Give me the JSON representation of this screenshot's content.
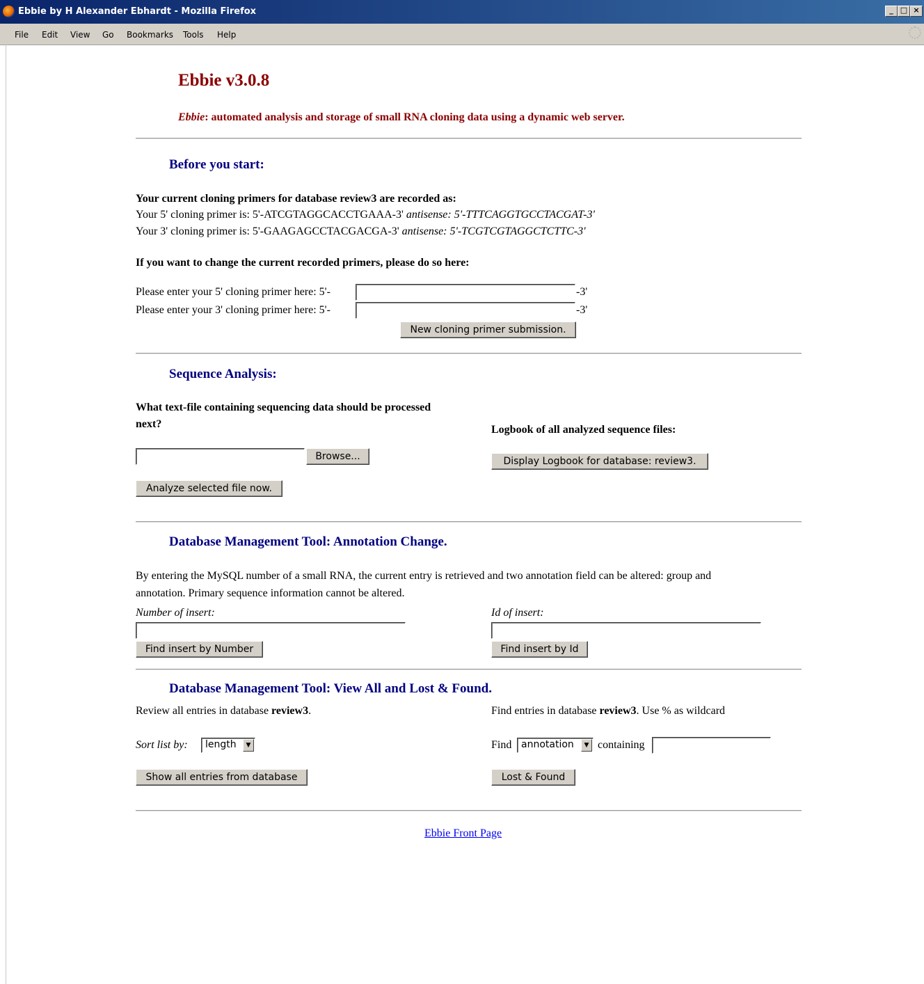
{
  "window": {
    "title": "Ebbie by H Alexander Ebhardt - Mozilla Firefox",
    "controls": [
      "_",
      "□",
      "×"
    ]
  },
  "menu": [
    "File",
    "Edit",
    "View",
    "Go",
    "Bookmarks",
    "Tools",
    "Help"
  ],
  "header": {
    "title": "Ebbie v3.0.8",
    "subtitle_italic": "Ebbie",
    "subtitle_rest": ": automated analysis and storage of small RNA cloning data using a dynamic web server."
  },
  "before": {
    "heading": "Before you start:",
    "recorded_label": "Your current cloning primers for database review3 are recorded as:",
    "primer5_text": "Your 5' cloning primer is: 5'-ATCGTAGGCACCTGAAA-3'",
    "primer5_antisense_label": "antisense:",
    "primer5_antisense": "5'-TTTCAGGTGCCTACGAT-3'",
    "primer3_text": "Your 3' cloning primer is: 5'-GAAGAGCCTACGACGA-3'",
    "primer3_antisense_label": "antisense:",
    "primer3_antisense": "5'-TCGTCGTAGGCTCTTC-3'",
    "change_label": "If you want to change the current recorded primers, please do so here:",
    "enter5_label": "Please enter your 5' cloning primer here: 5'-",
    "enter3_label": "Please enter your 3' cloning primer here: 5'-",
    "suffix": "-3'",
    "enter5_value": "",
    "enter3_value": "",
    "submit_label": "New cloning primer submission."
  },
  "analysis": {
    "heading": "Sequence Analysis:",
    "question_line1": "What text-file containing sequencing data should be processed",
    "question_line2": "next?",
    "file_value": "",
    "browse_label": "Browse...",
    "analyze_label": "Analyze selected file now.",
    "logbook_label": "Logbook of all analyzed sequence files:",
    "logbook_button": "Display Logbook for database: review3."
  },
  "annotation": {
    "heading": "Database Management Tool: Annotation Change.",
    "desc_line1": "By entering the MySQL number of a small RNA, the current entry is retrieved and two annotation field can be altered: group and",
    "desc_line2": "annotation. Primary sequence information cannot be altered.",
    "number_label": "Number of insert:",
    "number_value": "",
    "find_number_button": "Find insert by Number",
    "id_label": "Id of insert:",
    "id_value": "",
    "find_id_button": "Find insert by Id"
  },
  "viewall": {
    "heading": "Database Management Tool: View All and Lost & Found.",
    "review_prefix": "Review all entries in database ",
    "db_name": "review3",
    "review_suffix": ".",
    "sort_label": "Sort list by:",
    "sort_value": "length",
    "show_all_button": "Show all entries from database",
    "find_prefix": "Find entries in database ",
    "find_suffix": ". Use % as wildcard",
    "find_label": "Find",
    "find_field_value": "annotation",
    "containing_label": "containing",
    "containing_value": "",
    "lost_found_button": "Lost & Found"
  },
  "footer": {
    "front_page_link": "Ebbie Front Page"
  }
}
